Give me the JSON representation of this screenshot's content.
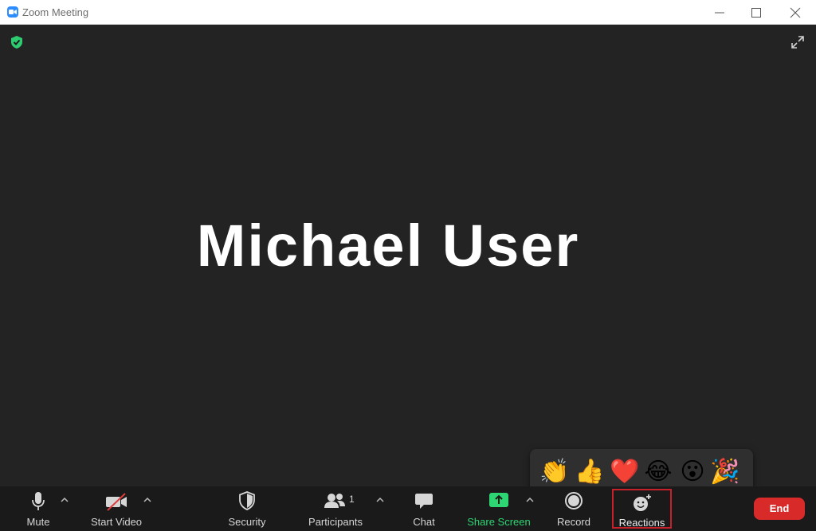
{
  "window": {
    "title": "Zoom Meeting"
  },
  "stage": {
    "participant_name": "Michael User"
  },
  "reactions": [
    {
      "emoji": "👏",
      "name": "clap"
    },
    {
      "emoji": "👍",
      "name": "thumbs-up"
    },
    {
      "emoji": "❤️",
      "name": "heart"
    },
    {
      "emoji": "😂",
      "name": "tears-of-joy"
    },
    {
      "emoji": "😮",
      "name": "open-mouth"
    },
    {
      "emoji": "🎉",
      "name": "tada"
    }
  ],
  "toolbar": {
    "mute_label": "Mute",
    "video_label": "Start Video",
    "security_label": "Security",
    "participants_label": "Participants",
    "participants_count": "1",
    "chat_label": "Chat",
    "share_label": "Share Screen",
    "record_label": "Record",
    "reactions_label": "Reactions",
    "end_label": "End"
  },
  "colors": {
    "accent_green": "#2ed573",
    "end_red": "#d92a2a",
    "highlight_red": "#c8202b",
    "zoom_blue": "#2d8cff"
  }
}
